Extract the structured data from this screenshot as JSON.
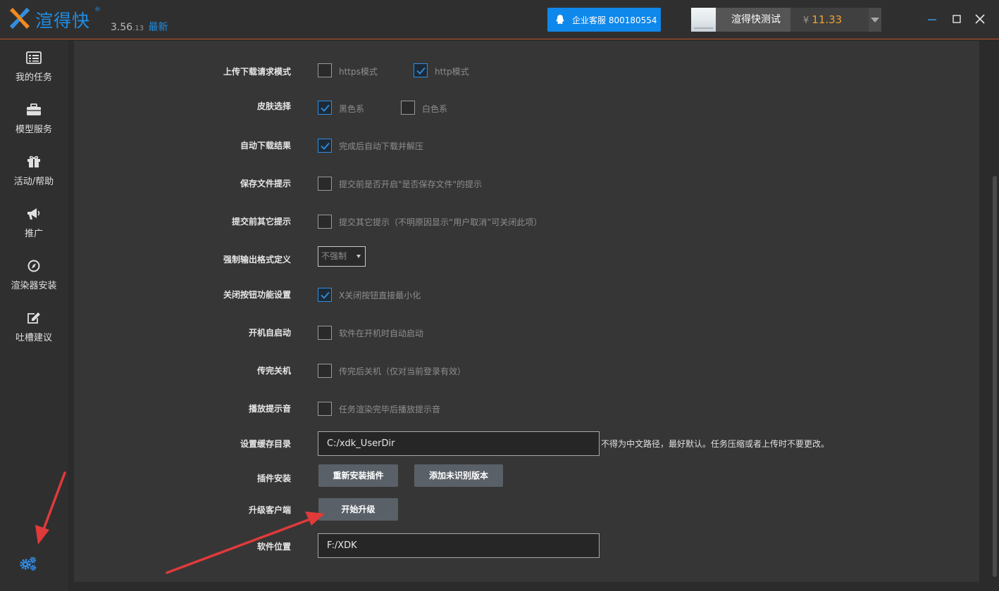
{
  "app": {
    "name": "渲得快",
    "registered_mark": "®",
    "version_major": "3.56",
    "version_build": ".13",
    "version_status": "最新"
  },
  "header": {
    "service_label": "企业客服 800180554",
    "username": "渲得快测试",
    "currency": "¥",
    "balance": "11.33"
  },
  "sidebar": {
    "items": [
      {
        "label": "我的任务",
        "icon": "task-list-icon"
      },
      {
        "label": "模型服务",
        "icon": "briefcase-icon"
      },
      {
        "label": "活动/帮助",
        "icon": "gift-icon"
      },
      {
        "label": "推广",
        "icon": "megaphone-icon"
      },
      {
        "label": "渲染器安装",
        "icon": "compass-icon"
      },
      {
        "label": "吐槽建议",
        "icon": "edit-icon"
      }
    ],
    "settings_icon": "settings-gears-icon"
  },
  "settings": {
    "upload_mode": {
      "label": "上传下载请求模式",
      "https": "https模式",
      "https_checked": false,
      "http": "http模式",
      "http_checked": true
    },
    "skin": {
      "label": "皮肤选择",
      "dark": "黑色系",
      "dark_checked": true,
      "light": "白色系",
      "light_checked": false
    },
    "auto_download": {
      "label": "自动下载结果",
      "option": "完成后自动下载并解压",
      "checked": true
    },
    "save_prompt": {
      "label": "保存文件提示",
      "option": "提交前是否开启\"是否保存文件\"的提示",
      "checked": false
    },
    "other_prompt": {
      "label": "提交前其它提示",
      "option": "提交其它提示（不明原因显示“用户取消”可关闭此项）",
      "checked": false
    },
    "force_format": {
      "label": "强制输出格式定义",
      "selected": "不强制"
    },
    "close_button": {
      "label": "关闭按钮功能设置",
      "option": "X关闭按钮直接最小化",
      "checked": true
    },
    "autostart": {
      "label": "开机自启动",
      "option": "软件在开机时自动启动",
      "checked": false
    },
    "shutdown": {
      "label": "传完关机",
      "option": "传完后关机（仅对当前登录有效）",
      "checked": false
    },
    "sound": {
      "label": "播放提示音",
      "option": "任务渲染完毕后播放提示音",
      "checked": false
    },
    "cache_dir": {
      "label": "设置缓存目录",
      "value": "C:/xdk_UserDir",
      "hint": "不得为中文路径，最好默认。任务压缩或者上传时不要更改。"
    },
    "plugin": {
      "label": "插件安装",
      "reinstall": "重新安装插件",
      "add_version": "添加未识别版本"
    },
    "upgrade": {
      "label": "升级客户端",
      "button": "开始升级"
    },
    "location": {
      "label": "软件位置",
      "value": "F:/XDK"
    }
  },
  "colors": {
    "accent": "#1f8ee6",
    "service_button": "#0f88eb",
    "balance": "#f1a230",
    "annotation_arrow": "#e03a3a",
    "title_bar_border": "#c4572b"
  }
}
